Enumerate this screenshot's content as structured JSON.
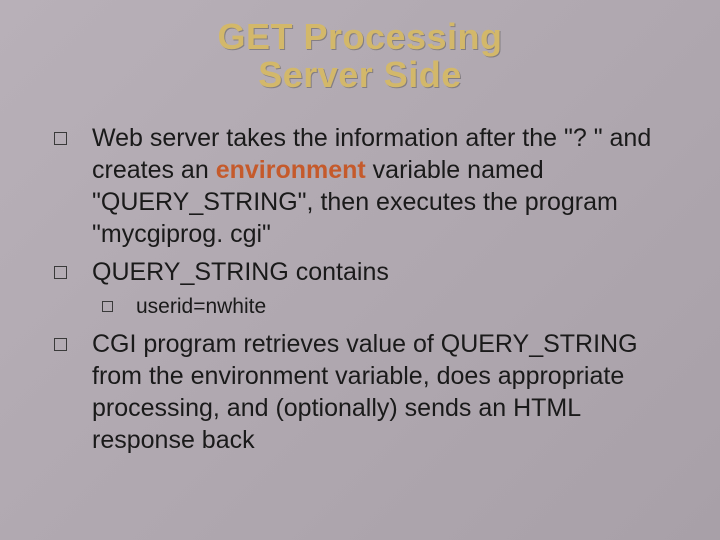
{
  "title_line1": "GET Processing",
  "title_line2": "Server Side",
  "bullets": [
    {
      "pre": "Web server takes the information after the \"? \" and creates an ",
      "emph": "environment",
      "post": " variable named \"QUERY_STRING\", then executes the program \"mycgiprog. cgi\""
    },
    {
      "text": "QUERY_STRING contains",
      "sub": [
        {
          "text": "userid=nwhite"
        }
      ]
    },
    {
      "text": "CGI program retrieves value of QUERY_STRING from the environment variable, does appropriate processing, and (optionally) sends an HTML response back"
    }
  ]
}
